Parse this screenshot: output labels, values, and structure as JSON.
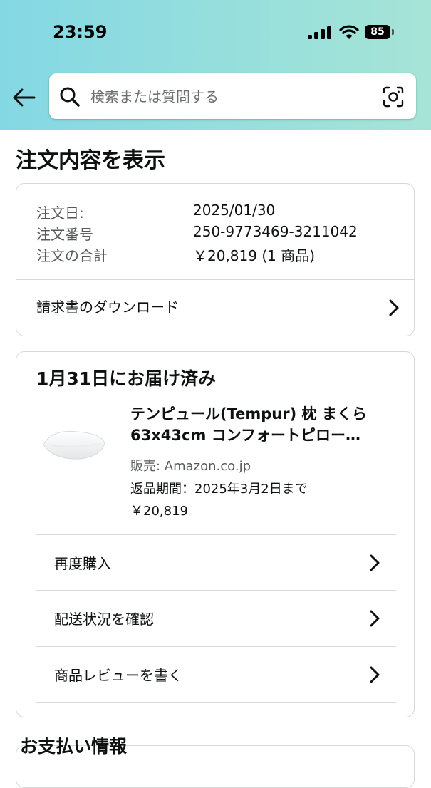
{
  "status_bar": {
    "time": "23:59",
    "battery": "85"
  },
  "search": {
    "placeholder": "検索または質問する"
  },
  "page_title": "注文内容を表示",
  "order_summary": {
    "rows": [
      {
        "label": "注文日:",
        "value": "2025/01/30"
      },
      {
        "label": "注文番号",
        "value": "250-9773469-3211042"
      },
      {
        "label": "注文の合計",
        "value": "￥20,819 (1 商品)"
      }
    ],
    "invoice_link": "請求書のダウンロード"
  },
  "delivery": {
    "title": "1月31日にお届け済み",
    "product": {
      "title_line1": "テンピュール(Tempur) 枕 まくら",
      "title_line2": "63x43cm コンフォートピロー…",
      "seller": "販売: Amazon.co.jp",
      "return_period": "返品期間：2025年3月2日まで",
      "price": "￥20,819"
    },
    "actions": [
      {
        "label": "再度購入"
      },
      {
        "label": "配送状況を確認"
      },
      {
        "label": "商品レビューを書く"
      }
    ]
  },
  "payment": {
    "title": "お支払い情報"
  },
  "icons": {
    "back": "back-arrow-icon",
    "search": "search-icon",
    "camera": "camera-scan-icon",
    "chevron": "chevron-right-icon"
  },
  "colors": {
    "header_gradient_start": "#84d8e4",
    "header_gradient_end": "#a6e4d6",
    "border": "#d5d9d9",
    "secondary_text": "#565959"
  }
}
